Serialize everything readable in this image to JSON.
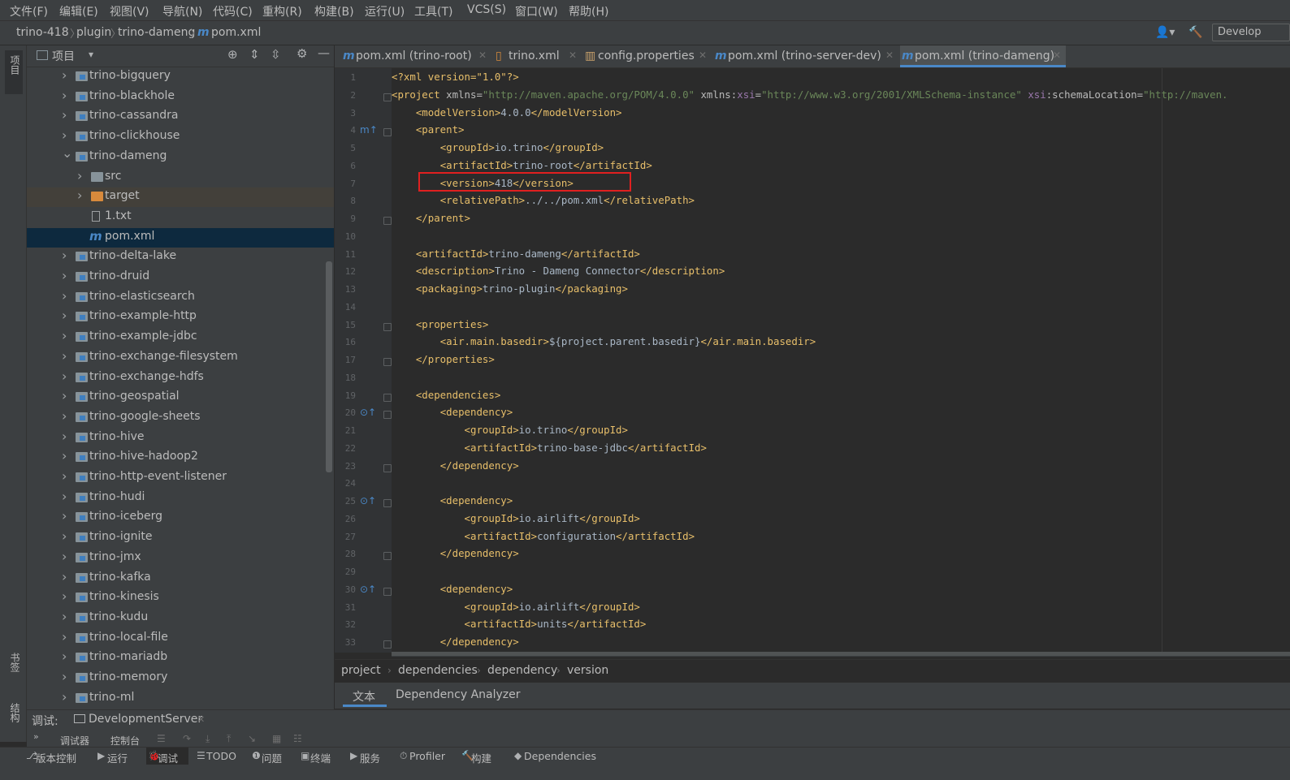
{
  "menu": [
    "文件(F)",
    "编辑(E)",
    "视图(V)",
    "导航(N)",
    "代码(C)",
    "重构(R)",
    "构建(B)",
    "运行(U)",
    "工具(T)",
    "VCS(S)",
    "窗口(W)",
    "帮助(H)"
  ],
  "breadcrumb": {
    "root": "trino-418",
    "plugin": "plugin",
    "module": "trino-dameng",
    "file": "pom.xml"
  },
  "run_config": "Develop",
  "left_stripe": {
    "project": "项目",
    "bookmarks": "书签",
    "structure": "结构"
  },
  "project_panel": {
    "title": "项目"
  },
  "tree": [
    {
      "label": "trino-bigquery",
      "kind": "module",
      "arrow": "›",
      "indent": 0
    },
    {
      "label": "trino-blackhole",
      "kind": "module",
      "arrow": "›",
      "indent": 0
    },
    {
      "label": "trino-cassandra",
      "kind": "module",
      "arrow": "›",
      "indent": 0
    },
    {
      "label": "trino-clickhouse",
      "kind": "module",
      "arrow": "›",
      "indent": 0
    },
    {
      "label": "trino-dameng",
      "kind": "module",
      "arrow": "⌄",
      "indent": 0
    },
    {
      "label": "src",
      "kind": "folder",
      "arrow": "›",
      "indent": 1
    },
    {
      "label": "target",
      "kind": "excluded",
      "arrow": "›",
      "indent": 1
    },
    {
      "label": "1.txt",
      "kind": "file",
      "arrow": "",
      "indent": 1
    },
    {
      "label": "pom.xml",
      "kind": "maven",
      "arrow": "",
      "indent": 1
    },
    {
      "label": "trino-delta-lake",
      "kind": "module",
      "arrow": "›",
      "indent": 0
    },
    {
      "label": "trino-druid",
      "kind": "module",
      "arrow": "›",
      "indent": 0
    },
    {
      "label": "trino-elasticsearch",
      "kind": "module",
      "arrow": "›",
      "indent": 0
    },
    {
      "label": "trino-example-http",
      "kind": "module",
      "arrow": "›",
      "indent": 0
    },
    {
      "label": "trino-example-jdbc",
      "kind": "module",
      "arrow": "›",
      "indent": 0
    },
    {
      "label": "trino-exchange-filesystem",
      "kind": "module",
      "arrow": "›",
      "indent": 0
    },
    {
      "label": "trino-exchange-hdfs",
      "kind": "module",
      "arrow": "›",
      "indent": 0
    },
    {
      "label": "trino-geospatial",
      "kind": "module",
      "arrow": "›",
      "indent": 0
    },
    {
      "label": "trino-google-sheets",
      "kind": "module",
      "arrow": "›",
      "indent": 0
    },
    {
      "label": "trino-hive",
      "kind": "module",
      "arrow": "›",
      "indent": 0
    },
    {
      "label": "trino-hive-hadoop2",
      "kind": "module",
      "arrow": "›",
      "indent": 0
    },
    {
      "label": "trino-http-event-listener",
      "kind": "module",
      "arrow": "›",
      "indent": 0
    },
    {
      "label": "trino-hudi",
      "kind": "module",
      "arrow": "›",
      "indent": 0
    },
    {
      "label": "trino-iceberg",
      "kind": "module",
      "arrow": "›",
      "indent": 0
    },
    {
      "label": "trino-ignite",
      "kind": "module",
      "arrow": "›",
      "indent": 0
    },
    {
      "label": "trino-jmx",
      "kind": "module",
      "arrow": "›",
      "indent": 0
    },
    {
      "label": "trino-kafka",
      "kind": "module",
      "arrow": "›",
      "indent": 0
    },
    {
      "label": "trino-kinesis",
      "kind": "module",
      "arrow": "›",
      "indent": 0
    },
    {
      "label": "trino-kudu",
      "kind": "module",
      "arrow": "›",
      "indent": 0
    },
    {
      "label": "trino-local-file",
      "kind": "module",
      "arrow": "›",
      "indent": 0
    },
    {
      "label": "trino-mariadb",
      "kind": "module",
      "arrow": "›",
      "indent": 0
    },
    {
      "label": "trino-memory",
      "kind": "module",
      "arrow": "›",
      "indent": 0
    },
    {
      "label": "trino-ml",
      "kind": "module",
      "arrow": "›",
      "indent": 0
    }
  ],
  "selected_tree_item": "pom.xml",
  "tabs": [
    {
      "label": "pom.xml (trino-root)",
      "icon": "maven-icon",
      "active": false
    },
    {
      "label": "trino.xml",
      "icon": "xml-file-icon",
      "active": false
    },
    {
      "label": "config.properties",
      "icon": "properties-file-icon",
      "active": false
    },
    {
      "label": "pom.xml (trino-server-dev)",
      "icon": "maven-icon",
      "active": false
    },
    {
      "label": "pom.xml (trino-dameng)",
      "icon": "maven-icon",
      "active": true
    }
  ],
  "code_lines": [
    [
      [
        "pi",
        "<?xml version=\"1.0\"?>"
      ]
    ],
    [
      [
        "tag",
        "<project "
      ],
      [
        "an",
        "xmlns="
      ],
      [
        "av",
        "\"http://maven.apache.org/POM/4.0.0\" "
      ],
      [
        "an",
        "xmlns:"
      ],
      [
        "ns",
        "xsi"
      ],
      [
        "an",
        "="
      ],
      [
        "av",
        "\"http://www.w3.org/2001/XMLSchema-instance\" "
      ],
      [
        "ns",
        "xsi"
      ],
      [
        "an",
        ":schemaLocation="
      ],
      [
        "av",
        "\"http://maven."
      ]
    ],
    [
      [
        "txt",
        "    "
      ],
      [
        "tag",
        "<modelVersion>"
      ],
      [
        "txt",
        "4.0.0"
      ],
      [
        "tag",
        "</modelVersion>"
      ]
    ],
    [
      [
        "txt",
        "    "
      ],
      [
        "tag",
        "<parent>"
      ]
    ],
    [
      [
        "txt",
        "        "
      ],
      [
        "tag",
        "<groupId>"
      ],
      [
        "txt",
        "io.trino"
      ],
      [
        "tag",
        "</groupId>"
      ]
    ],
    [
      [
        "txt",
        "        "
      ],
      [
        "tag",
        "<artifactId>"
      ],
      [
        "txt",
        "trino-root"
      ],
      [
        "tag",
        "</artifactId>"
      ]
    ],
    [
      [
        "txt",
        "        "
      ],
      [
        "tag",
        "<version>"
      ],
      [
        "txt",
        "418"
      ],
      [
        "tag",
        "</version>"
      ]
    ],
    [
      [
        "txt",
        "        "
      ],
      [
        "tag",
        "<relativePath>"
      ],
      [
        "txt",
        "../../pom.xml"
      ],
      [
        "tag",
        "</relativePath>"
      ]
    ],
    [
      [
        "txt",
        "    "
      ],
      [
        "tag",
        "</parent>"
      ]
    ],
    [
      [
        "txt",
        ""
      ]
    ],
    [
      [
        "txt",
        "    "
      ],
      [
        "tag",
        "<artifactId>"
      ],
      [
        "txt",
        "trino-dameng"
      ],
      [
        "tag",
        "</artifactId>"
      ]
    ],
    [
      [
        "txt",
        "    "
      ],
      [
        "tag",
        "<description>"
      ],
      [
        "txt",
        "Trino - Dameng Connector"
      ],
      [
        "tag",
        "</description>"
      ]
    ],
    [
      [
        "txt",
        "    "
      ],
      [
        "tag",
        "<packaging>"
      ],
      [
        "txt",
        "trino-plugin"
      ],
      [
        "tag",
        "</packaging>"
      ]
    ],
    [
      [
        "txt",
        ""
      ]
    ],
    [
      [
        "txt",
        "    "
      ],
      [
        "tag",
        "<properties>"
      ]
    ],
    [
      [
        "txt",
        "        "
      ],
      [
        "tag",
        "<air.main.basedir>"
      ],
      [
        "txt",
        "${project.parent.basedir}"
      ],
      [
        "tag",
        "</air.main.basedir>"
      ]
    ],
    [
      [
        "txt",
        "    "
      ],
      [
        "tag",
        "</properties>"
      ]
    ],
    [
      [
        "txt",
        ""
      ]
    ],
    [
      [
        "txt",
        "    "
      ],
      [
        "tag",
        "<dependencies>"
      ]
    ],
    [
      [
        "txt",
        "        "
      ],
      [
        "tag",
        "<dependency>"
      ]
    ],
    [
      [
        "txt",
        "            "
      ],
      [
        "tag",
        "<groupId>"
      ],
      [
        "txt",
        "io.trino"
      ],
      [
        "tag",
        "</groupId>"
      ]
    ],
    [
      [
        "txt",
        "            "
      ],
      [
        "tag",
        "<artifactId>"
      ],
      [
        "txt",
        "trino-base-jdbc"
      ],
      [
        "tag",
        "</artifactId>"
      ]
    ],
    [
      [
        "txt",
        "        "
      ],
      [
        "tag",
        "</dependency>"
      ]
    ],
    [
      [
        "txt",
        ""
      ]
    ],
    [
      [
        "txt",
        "        "
      ],
      [
        "tag",
        "<dependency>"
      ]
    ],
    [
      [
        "txt",
        "            "
      ],
      [
        "tag",
        "<groupId>"
      ],
      [
        "txt",
        "io.airlift"
      ],
      [
        "tag",
        "</groupId>"
      ]
    ],
    [
      [
        "txt",
        "            "
      ],
      [
        "tag",
        "<artifactId>"
      ],
      [
        "txt",
        "configuration"
      ],
      [
        "tag",
        "</artifactId>"
      ]
    ],
    [
      [
        "txt",
        "        "
      ],
      [
        "tag",
        "</dependency>"
      ]
    ],
    [
      [
        "txt",
        ""
      ]
    ],
    [
      [
        "txt",
        "        "
      ],
      [
        "tag",
        "<dependency>"
      ]
    ],
    [
      [
        "txt",
        "            "
      ],
      [
        "tag",
        "<groupId>"
      ],
      [
        "txt",
        "io.airlift"
      ],
      [
        "tag",
        "</groupId>"
      ]
    ],
    [
      [
        "txt",
        "            "
      ],
      [
        "tag",
        "<artifactId>"
      ],
      [
        "txt",
        "units"
      ],
      [
        "tag",
        "</artifactId>"
      ]
    ],
    [
      [
        "txt",
        "        "
      ],
      [
        "tag",
        "</dependency>"
      ]
    ]
  ],
  "line_numbers": [
    "1",
    "2",
    "3",
    "4",
    "5",
    "6",
    "7",
    "8",
    "9",
    "10",
    "11",
    "12",
    "13",
    "14",
    "15",
    "16",
    "17",
    "18",
    "19",
    "20",
    "21",
    "22",
    "23",
    "24",
    "25",
    "26",
    "27",
    "28",
    "29",
    "30",
    "31",
    "32",
    "33"
  ],
  "editor_breadcrumbs": [
    "project",
    "dependencies",
    "dependency",
    "version"
  ],
  "editor_bottom_tabs": [
    "文本",
    "Dependency Analyzer"
  ],
  "debug": {
    "label": "调试:",
    "config": "DevelopmentServer",
    "sub_tabs": [
      "调试器",
      "控制台"
    ]
  },
  "tool_windows": [
    "版本控制",
    "运行",
    "调试",
    "TODO",
    "问题",
    "终端",
    "服务",
    "Profiler",
    "构建",
    "Dependencies"
  ],
  "colors": {
    "accent": "#4a88c7",
    "highlight_box": "#e02020",
    "selection": "#0d293e"
  }
}
